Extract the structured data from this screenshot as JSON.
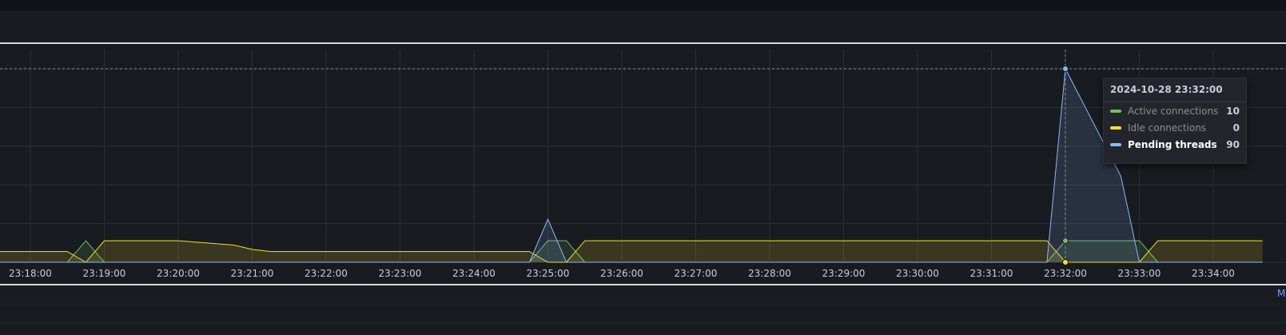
{
  "chart_data": {
    "type": "area",
    "x_ticks": [
      "23:18:00",
      "23:19:00",
      "23:20:00",
      "23:21:00",
      "23:22:00",
      "23:23:00",
      "23:24:00",
      "23:25:00",
      "23:26:00",
      "23:27:00",
      "23:28:00",
      "23:29:00",
      "23:30:00",
      "23:31:00",
      "23:32:00",
      "23:33:00",
      "23:34:00"
    ],
    "ylim": [
      0,
      90
    ],
    "series": [
      {
        "name": "Active connections",
        "color": "#73bf69",
        "points": [
          [
            "23:17:10",
            0
          ],
          [
            "23:18:00",
            0
          ],
          [
            "23:18:30",
            0
          ],
          [
            "23:18:45",
            10
          ],
          [
            "23:19:00",
            0
          ],
          [
            "23:24:45",
            0
          ],
          [
            "23:25:00",
            10
          ],
          [
            "23:25:15",
            10
          ],
          [
            "23:25:30",
            0
          ],
          [
            "23:31:45",
            0
          ],
          [
            "23:32:00",
            10
          ],
          [
            "23:32:30",
            10
          ],
          [
            "23:33:00",
            10
          ],
          [
            "23:33:15",
            0
          ],
          [
            "23:34:40",
            0
          ]
        ]
      },
      {
        "name": "Idle connections",
        "color": "#fade2a",
        "points": [
          [
            "23:17:10",
            8
          ],
          [
            "23:17:20",
            5
          ],
          [
            "23:18:00",
            5
          ],
          [
            "23:18:30",
            5
          ],
          [
            "23:18:45",
            0
          ],
          [
            "23:19:00",
            10
          ],
          [
            "23:20:00",
            10
          ],
          [
            "23:20:45",
            8
          ],
          [
            "23:21:00",
            6
          ],
          [
            "23:21:15",
            5
          ],
          [
            "23:24:30",
            5
          ],
          [
            "23:24:45",
            5
          ],
          [
            "23:25:00",
            0
          ],
          [
            "23:25:15",
            0
          ],
          [
            "23:25:30",
            10
          ],
          [
            "23:31:30",
            10
          ],
          [
            "23:31:45",
            10
          ],
          [
            "23:32:00",
            0
          ],
          [
            "23:33:00",
            0
          ],
          [
            "23:33:15",
            10
          ],
          [
            "23:34:40",
            10
          ]
        ]
      },
      {
        "name": "Pending threads",
        "color": "#8ab8ff",
        "points": [
          [
            "23:17:10",
            0
          ],
          [
            "23:24:45",
            0
          ],
          [
            "23:25:00",
            20
          ],
          [
            "23:25:15",
            0
          ],
          [
            "23:31:45",
            0
          ],
          [
            "23:32:00",
            90
          ],
          [
            "23:32:45",
            40
          ],
          [
            "23:33:00",
            0
          ],
          [
            "23:34:40",
            0
          ]
        ]
      }
    ],
    "tooltip": {
      "time": "2024-10-28 23:32:00",
      "rows": [
        {
          "label": "Active connections",
          "value": "10",
          "color": "#73bf69",
          "highlight": false
        },
        {
          "label": "Idle connections",
          "value": "0",
          "color": "#fade2a",
          "highlight": false
        },
        {
          "label": "Pending threads",
          "value": "90",
          "color": "#8ab8ff",
          "highlight": true
        }
      ]
    },
    "hover_time": "23:32:00"
  },
  "legend_fragment": "M"
}
